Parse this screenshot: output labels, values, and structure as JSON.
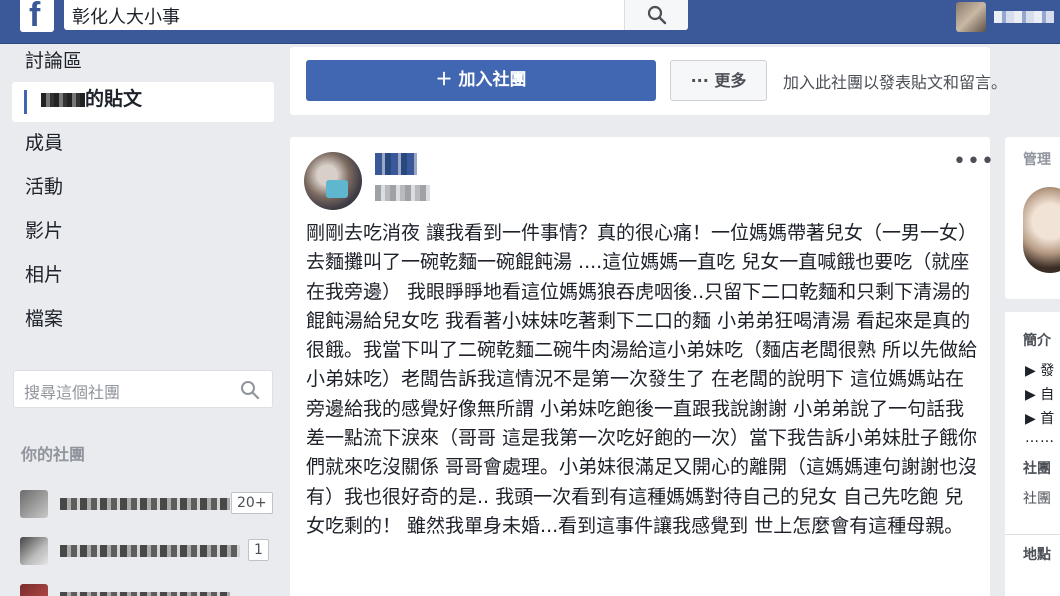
{
  "header": {
    "logo": "f",
    "search_value": "彰化人大小事"
  },
  "nav": {
    "items": [
      {
        "label": "討論區"
      },
      {
        "label": "的貼文"
      },
      {
        "label": "成員"
      },
      {
        "label": "活動"
      },
      {
        "label": "影片"
      },
      {
        "label": "相片"
      },
      {
        "label": "檔案"
      }
    ],
    "group_search_placeholder": "搜尋這個社團",
    "your_groups_title": "你的社團",
    "groups": [
      {
        "badge": "20+"
      },
      {
        "badge": "1"
      }
    ]
  },
  "actions": {
    "join_label": "＋ 加入社團",
    "more_label": "··· 更多",
    "join_hint": "加入此社團以發表貼文和留言。"
  },
  "post": {
    "menu": "•••",
    "body": "剛剛去吃消夜 讓我看到一件事情？真的很心痛！一位媽媽帶著兒女（一男一女）去麵攤叫了一碗乾麵一碗餛飩湯 ....這位媽媽一直吃 兒女一直喊餓也要吃（就座在我旁邊） 我眼睜睜地看這位媽媽狼吞虎咽後..只留下二口乾麵和只剩下清湯的餛飩湯給兒女吃 我看著小妹妹吃著剩下二口的麵 小弟弟狂喝清湯 看起來是真的很餓。我當下叫了二碗乾麵二碗牛肉湯給這小弟妹吃（麵店老闆很熟 所以先做給小弟妹吃）老闆告訴我這情況不是第一次發生了 在老闆的說明下 這位媽媽站在旁邊給我的感覺好像無所謂 小弟妹吃飽後一直跟我說謝謝 小弟弟說了一句話我差一點流下淚來（哥哥 這是我第一次吃好飽的一次）當下我告訴小弟妹肚子餓你們就來吃沒關係 哥哥會處理。小弟妹很滿足又開心的離開（這媽媽連句謝謝也沒有）我也很好奇的是.. 我頭一次看到有這種媽媽對待自己的兒女 自己先吃飽 兒女吃剩的！ 雖然我單身未婚...看到這事件讓我感覺到 世上怎麼會有這種母親。"
  },
  "right": {
    "admin_label": "管理",
    "intro_label": "簡介",
    "intro_items": [
      "▶ 發",
      "▶ 自",
      "▶ 首"
    ],
    "dots": "……",
    "group_type_label": "社團",
    "group_type_value": "社團",
    "location_label": "地點"
  }
}
